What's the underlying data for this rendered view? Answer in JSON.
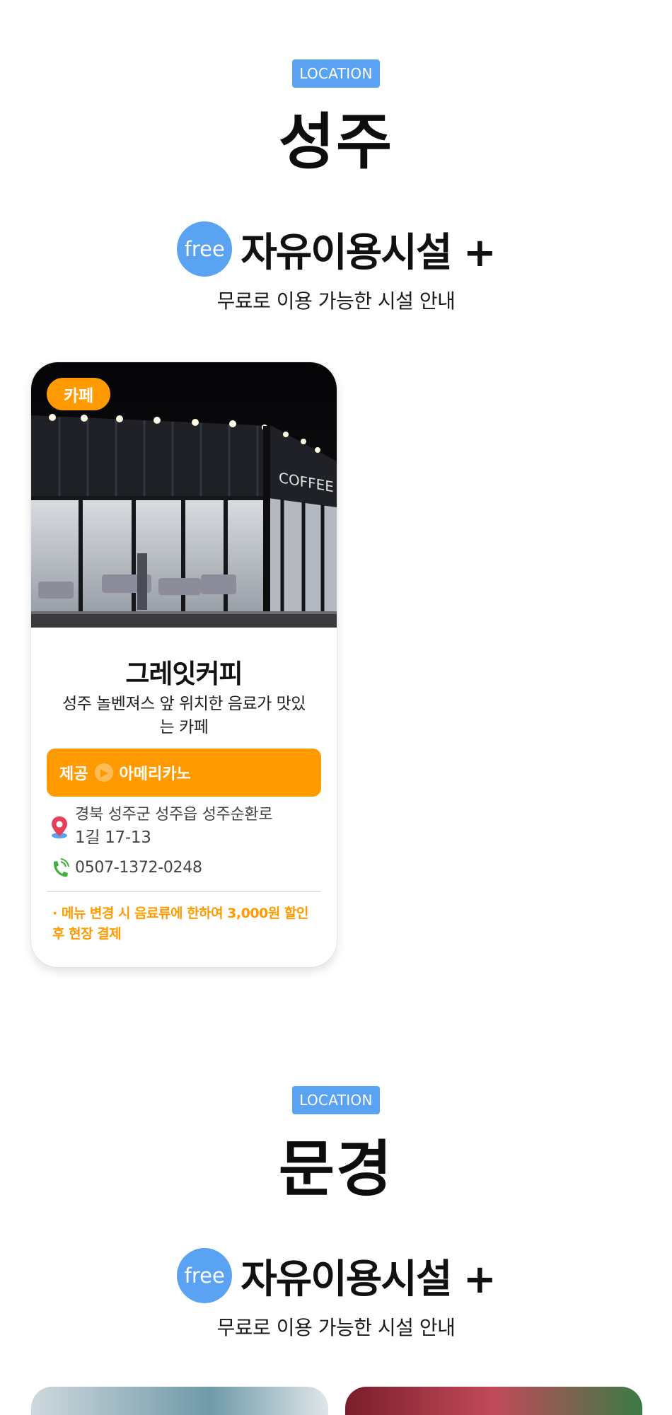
{
  "sections": [
    {
      "badge": "LOCATION",
      "region": "성주",
      "free_label": "free",
      "free_title": "자유이용시설 +",
      "subtitle": "무료로 이용 가능한 시설 안내"
    },
    {
      "badge": "LOCATION",
      "region": "문경",
      "free_label": "free",
      "free_title": "자유이용시설 +",
      "subtitle": "무료로 이용 가능한 시설 안내"
    }
  ],
  "card": {
    "category": "카페",
    "name": "그레잇커피",
    "description": "성주 놀벤져스 앞 위치한 음료가 맛있는 카페",
    "provide_label": "제공",
    "provide_item": "아메리카노",
    "address_line1": "경북 성주군 성주읍 성주순환로",
    "address_line2": "1길 17-13",
    "phone": "0507-1372-0248",
    "note": "· 메뉴 변경 시 음료류에 한하여 3,000원 할인 후 현장 결제",
    "sign_text": "COFFEE",
    "icons": {
      "address": "map-pin-icon",
      "phone": "phone-icon",
      "provide": "chevron-right-icon"
    }
  },
  "colors": {
    "accent_blue": "#5aa2f2",
    "accent_orange": "#ff9a00",
    "pin_red": "#e8405a",
    "phone_green": "#3fae3a"
  }
}
